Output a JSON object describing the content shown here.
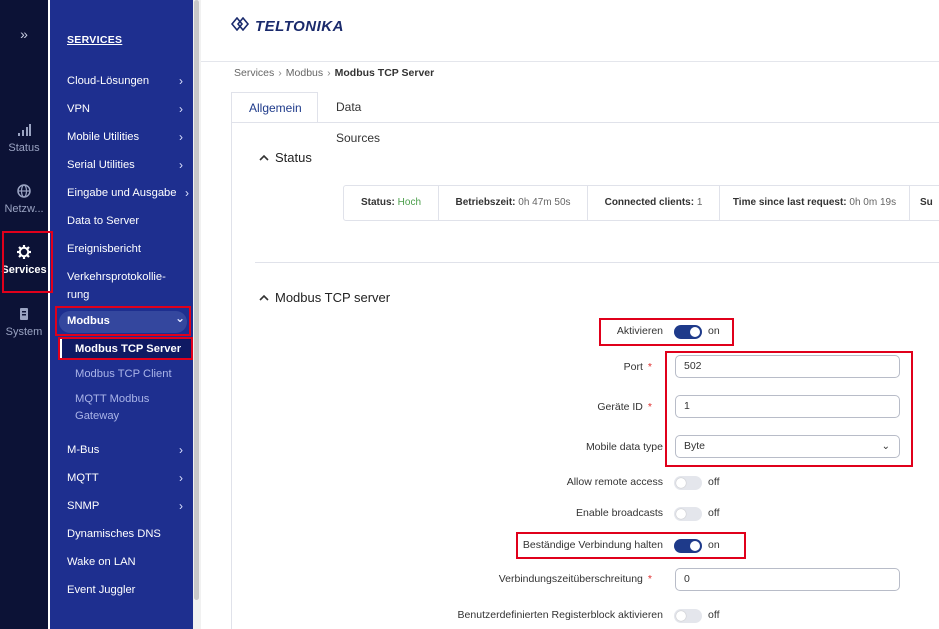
{
  "rail": {
    "expand_glyph": "»",
    "items": [
      {
        "label": "Status",
        "icon": "signal-icon"
      },
      {
        "label": "Netzw...",
        "icon": "globe-icon"
      },
      {
        "label": "Services",
        "icon": "gear-icon"
      },
      {
        "label": "System",
        "icon": "system-icon"
      }
    ]
  },
  "menu": {
    "title": "SERVICES",
    "items": [
      {
        "label": "Cloud-Lösungen",
        "chevron": "›"
      },
      {
        "label": "VPN",
        "chevron": "›"
      },
      {
        "label": "Mobile Utilities",
        "chevron": "›"
      },
      {
        "label": "Serial Utilities",
        "chevron": "›"
      },
      {
        "label": "Eingabe und Ausgabe",
        "chevron": "›"
      },
      {
        "label": "Data to Server"
      },
      {
        "label": "Ereignisbericht"
      },
      {
        "label": "Verkehrsprotokollie-"
      },
      {
        "label": "rung"
      },
      {
        "label": "Modbus",
        "chevron": "⌄"
      },
      {
        "label": "Modbus TCP Server"
      },
      {
        "label": "Modbus TCP Client"
      },
      {
        "label": "MQTT Modbus"
      },
      {
        "label": "Gateway"
      },
      {
        "label": "M-Bus",
        "chevron": "›"
      },
      {
        "label": "MQTT",
        "chevron": "›"
      },
      {
        "label": "SNMP",
        "chevron": "›"
      },
      {
        "label": "Dynamisches DNS"
      },
      {
        "label": "Wake on LAN"
      },
      {
        "label": "Event Juggler"
      }
    ]
  },
  "header": {
    "logo_text": "TELTONIKA"
  },
  "breadcrumb": {
    "items": [
      "Services",
      "Modbus",
      "Modbus TCP Server"
    ],
    "sep": "›"
  },
  "tabs": [
    {
      "label": "Allgemein"
    },
    {
      "label": "Data Sources"
    }
  ],
  "status_section": {
    "title": "Status",
    "caret": "^",
    "cells": [
      {
        "label": "Status:",
        "value": "Hoch"
      },
      {
        "label": "Betriebszeit:",
        "value": "0h 47m 50s"
      },
      {
        "label": "Connected clients:",
        "value": "1"
      },
      {
        "label": "Time since last request:",
        "value": "0h 0m 19s"
      },
      {
        "label": "Su",
        "value": ""
      }
    ]
  },
  "server_section": {
    "title": "Modbus TCP server",
    "caret": "^",
    "aktivieren": {
      "label": "Aktivieren",
      "state": "on"
    },
    "port": {
      "label": "Port",
      "value": "502",
      "required": "*"
    },
    "device_id": {
      "label": "Geräte ID",
      "value": "1",
      "required": "*"
    },
    "data_type": {
      "label": "Mobile data type",
      "value": "Byte",
      "chevron": "⌄"
    },
    "remote_access": {
      "label": "Allow remote access",
      "state": "off"
    },
    "broadcasts": {
      "label": "Enable broadcasts",
      "state": "off"
    },
    "keep_conn": {
      "label": "Beständige Verbindung halten",
      "state": "on"
    },
    "timeout": {
      "label": "Verbindungszeitüberschreitung",
      "value": "0",
      "required": "*"
    },
    "custom_block": {
      "label": "Benutzerdefinierten Registerblock aktivieren",
      "state": "off"
    }
  },
  "colors": {
    "highlight": "#e0001b",
    "menu_bg": "#1e2f8f",
    "rail_bg": "#0c1236",
    "toggle_on": "#1e3a8a"
  }
}
